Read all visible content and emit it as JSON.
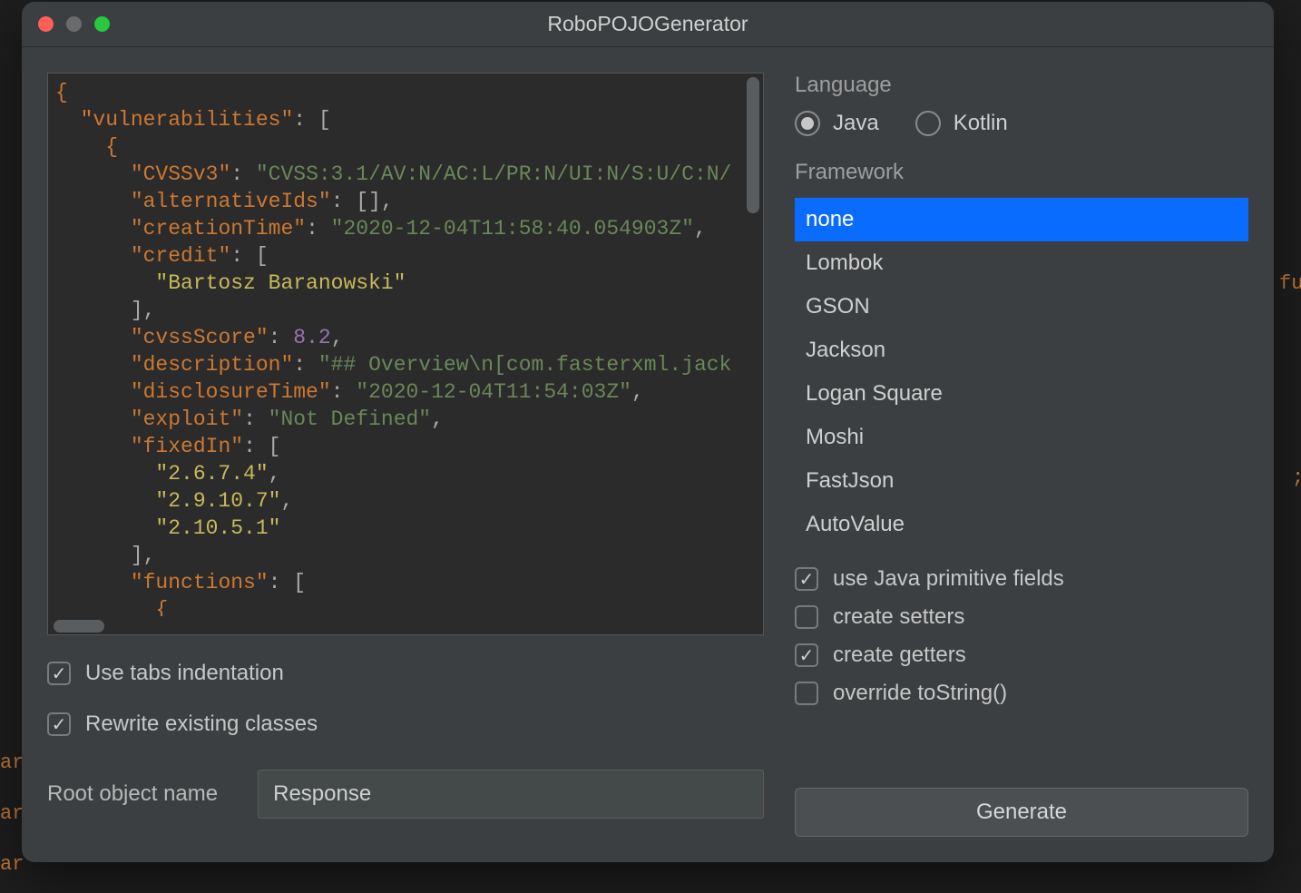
{
  "window": {
    "title": "RoboPOJOGenerator"
  },
  "editor": {
    "json_display_tokens": [
      [
        "b",
        "{"
      ],
      [
        "nl"
      ],
      [
        "pad",
        "  "
      ],
      [
        "k",
        "\"vulnerabilities\""
      ],
      [
        "p",
        ": ["
      ],
      [
        "nl"
      ],
      [
        "pad",
        "    "
      ],
      [
        "b",
        "{"
      ],
      [
        "nl"
      ],
      [
        "pad",
        "      "
      ],
      [
        "k",
        "\"CVSSv3\""
      ],
      [
        "p",
        ": "
      ],
      [
        "s",
        "\"CVSS:3.1/AV:N/AC:L/PR:N/UI:N/S:U/C:N/"
      ],
      [
        "nl"
      ],
      [
        "pad",
        "      "
      ],
      [
        "k",
        "\"alternativeIds\""
      ],
      [
        "p",
        ": []"
      ],
      [
        "p",
        ","
      ],
      [
        "nl"
      ],
      [
        "pad",
        "      "
      ],
      [
        "k",
        "\"creationTime\""
      ],
      [
        "p",
        ": "
      ],
      [
        "s",
        "\"2020-12-04T11:58:40.054903Z\""
      ],
      [
        "p",
        ","
      ],
      [
        "nl"
      ],
      [
        "pad",
        "      "
      ],
      [
        "k",
        "\"credit\""
      ],
      [
        "p",
        ": ["
      ],
      [
        "nl"
      ],
      [
        "pad",
        "        "
      ],
      [
        "sy",
        "\"Bartosz Baranowski\""
      ],
      [
        "nl"
      ],
      [
        "pad",
        "      "
      ],
      [
        "p",
        "]"
      ],
      [
        "p",
        ","
      ],
      [
        "nl"
      ],
      [
        "pad",
        "      "
      ],
      [
        "k",
        "\"cvssScore\""
      ],
      [
        "p",
        ": "
      ],
      [
        "n",
        "8.2"
      ],
      [
        "p",
        ","
      ],
      [
        "nl"
      ],
      [
        "pad",
        "      "
      ],
      [
        "k",
        "\"description\""
      ],
      [
        "p",
        ": "
      ],
      [
        "s",
        "\"## Overview\\n[com.fasterxml.jack"
      ],
      [
        "nl"
      ],
      [
        "pad",
        "      "
      ],
      [
        "k",
        "\"disclosureTime\""
      ],
      [
        "p",
        ": "
      ],
      [
        "s",
        "\"2020-12-04T11:54:03Z\""
      ],
      [
        "p",
        ","
      ],
      [
        "nl"
      ],
      [
        "pad",
        "      "
      ],
      [
        "k",
        "\"exploit\""
      ],
      [
        "p",
        ": "
      ],
      [
        "s",
        "\"Not Defined\""
      ],
      [
        "p",
        ","
      ],
      [
        "nl"
      ],
      [
        "pad",
        "      "
      ],
      [
        "k",
        "\"fixedIn\""
      ],
      [
        "p",
        ": ["
      ],
      [
        "nl"
      ],
      [
        "pad",
        "        "
      ],
      [
        "sy",
        "\"2.6.7.4\""
      ],
      [
        "p",
        ","
      ],
      [
        "nl"
      ],
      [
        "pad",
        "        "
      ],
      [
        "sy",
        "\"2.9.10.7\""
      ],
      [
        "p",
        ","
      ],
      [
        "nl"
      ],
      [
        "pad",
        "        "
      ],
      [
        "sy",
        "\"2.10.5.1\""
      ],
      [
        "nl"
      ],
      [
        "pad",
        "      "
      ],
      [
        "p",
        "]"
      ],
      [
        "p",
        ","
      ],
      [
        "nl"
      ],
      [
        "pad",
        "      "
      ],
      [
        "k",
        "\"functions\""
      ],
      [
        "p",
        ": ["
      ],
      [
        "nl"
      ],
      [
        "pad",
        "        "
      ],
      [
        "b",
        "{"
      ]
    ]
  },
  "left_options": {
    "tabs_indent": {
      "label": "Use tabs indentation",
      "checked": true
    },
    "rewrite": {
      "label": "Rewrite existing classes",
      "checked": true
    }
  },
  "root": {
    "label": "Root object name",
    "value": "Response"
  },
  "language": {
    "label": "Language",
    "options": [
      {
        "id": "java",
        "label": "Java",
        "selected": true
      },
      {
        "id": "kotlin",
        "label": "Kotlin",
        "selected": false
      }
    ]
  },
  "framework": {
    "label": "Framework",
    "items": [
      {
        "label": "none",
        "selected": true
      },
      {
        "label": "Lombok",
        "selected": false
      },
      {
        "label": "GSON",
        "selected": false
      },
      {
        "label": "Jackson",
        "selected": false
      },
      {
        "label": "Logan Square",
        "selected": false
      },
      {
        "label": "Moshi",
        "selected": false
      },
      {
        "label": "FastJson",
        "selected": false
      },
      {
        "label": "AutoValue",
        "selected": false
      }
    ]
  },
  "right_options": {
    "primitive": {
      "label": "use Java primitive fields",
      "checked": true
    },
    "setters": {
      "label": "create setters",
      "checked": false
    },
    "getters": {
      "label": "create getters",
      "checked": true
    },
    "tostring": {
      "label": "override toString()",
      "checked": false
    }
  },
  "generate": {
    "label": "Generate"
  },
  "bg": {
    "frag_fu": "fu",
    "frag_semi": ";",
    "frag_ar1": "ar",
    "frag_ar2": "ar",
    "frag_ar3": "ar"
  }
}
